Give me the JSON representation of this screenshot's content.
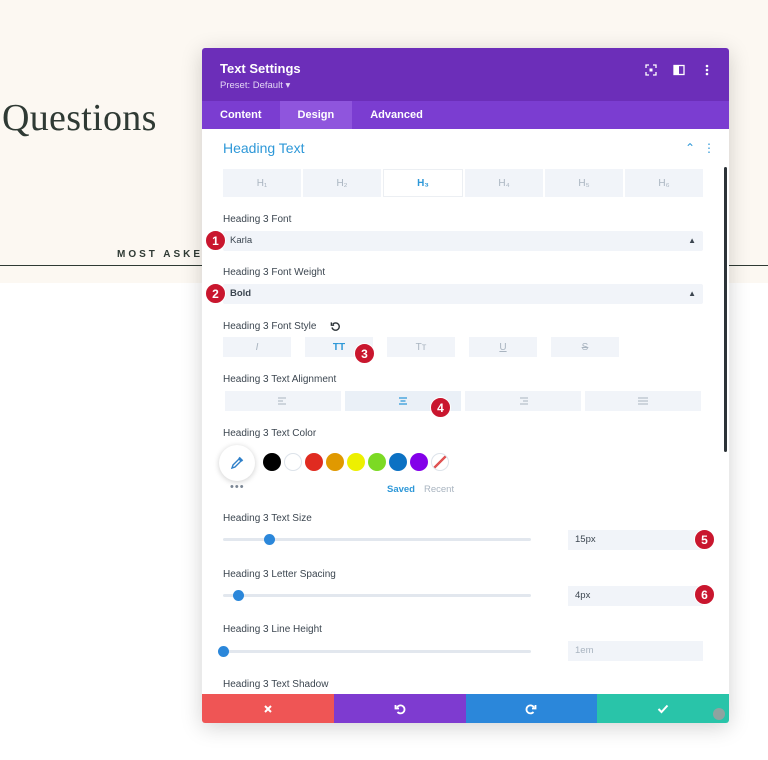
{
  "background": {
    "title": "Questions",
    "subtitle": "MOST ASKED"
  },
  "modal": {
    "title": "Text Settings",
    "preset": "Preset: Default ▾",
    "tabs": [
      "Content",
      "Design",
      "Advanced"
    ],
    "active_tab": "Design",
    "section_title": "Heading Text",
    "heading_tabs": [
      "H₁",
      "H₂",
      "H₃",
      "H₄",
      "H₅",
      "H₆"
    ],
    "active_heading": "H₃",
    "font_label": "Heading 3 Font",
    "font_value": "Karla",
    "weight_label": "Heading 3 Font Weight",
    "weight_value": "Bold",
    "style_label": "Heading 3 Font Style",
    "style_buttons": [
      "I",
      "TT",
      "Tт",
      "U",
      "S"
    ],
    "align_label": "Heading 3 Text Alignment",
    "color_label": "Heading 3 Text Color",
    "swatch_colors": [
      "#000000",
      "#ffffff",
      "#e02b20",
      "#e09900",
      "#edf000",
      "#7cda24",
      "#0c71c3",
      "#8300e9"
    ],
    "more": "•••",
    "saved_label": "Saved",
    "recent_label": "Recent",
    "size_label": "Heading 3 Text Size",
    "size_value": "15px",
    "size_fraction": 0.15,
    "spacing_label": "Heading 3 Letter Spacing",
    "spacing_value": "4px",
    "spacing_fraction": 0.05,
    "lineheight_label": "Heading 3 Line Height",
    "lineheight_value": "1em",
    "lineheight_fraction": 0.0,
    "shadow_label": "Heading 3 Text Shadow",
    "badges": [
      "1",
      "2",
      "3",
      "4",
      "5",
      "6"
    ],
    "footer_colors": {
      "cancel": "#ef5555",
      "undo": "#7e3bd0",
      "redo": "#2b87da",
      "save": "#29c4a9"
    },
    "accent": "#6c2eb9"
  }
}
